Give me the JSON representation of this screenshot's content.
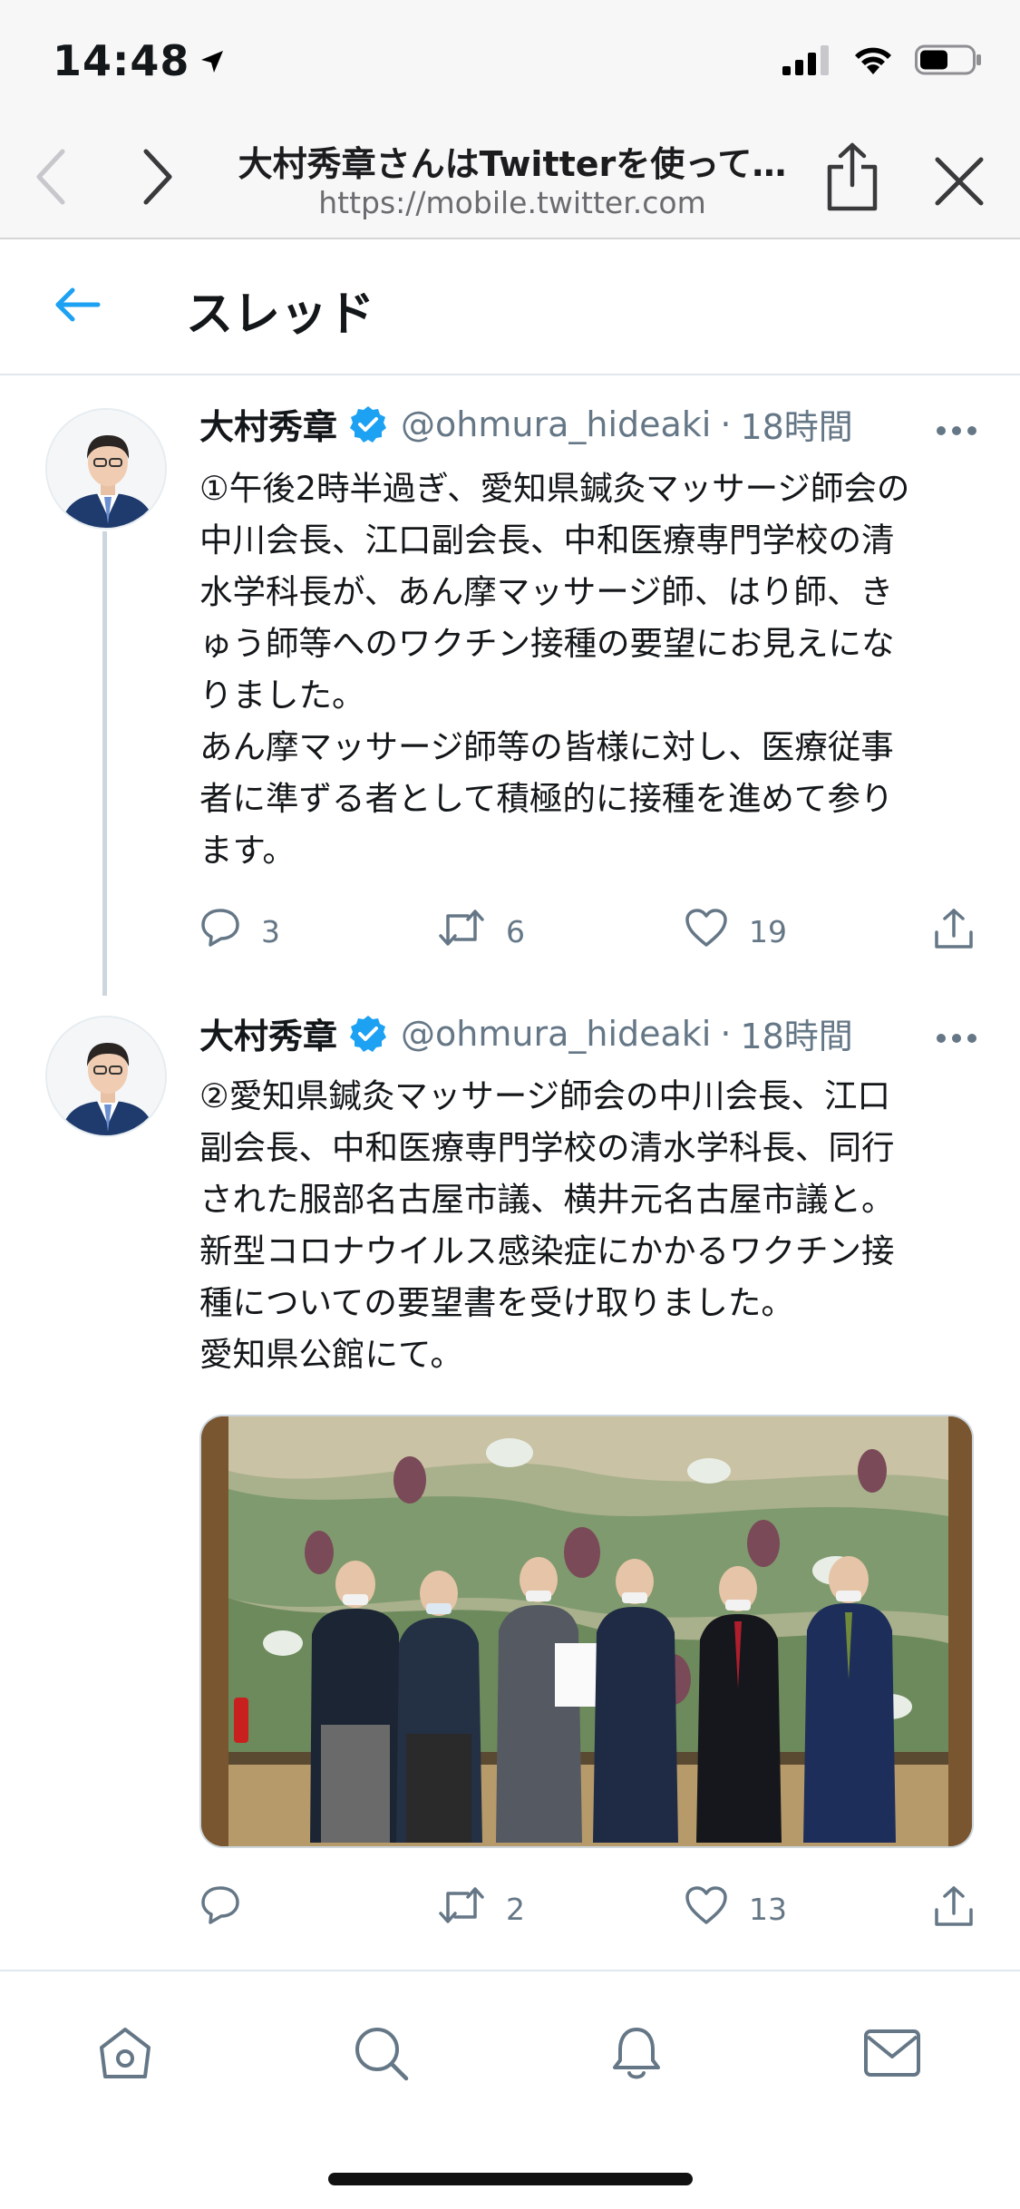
{
  "status_bar": {
    "time": "14:48",
    "icons": [
      "location-arrow-icon",
      "cellular-signal-icon",
      "wifi-icon",
      "battery-icon"
    ]
  },
  "browser": {
    "page_title": "大村秀章さんはTwitterを使って…",
    "url": "https://mobile.twitter.com",
    "icons": [
      "back-chevron-icon",
      "forward-chevron-icon",
      "share-icon",
      "close-icon"
    ]
  },
  "thread": {
    "title": "スレッド",
    "back_icon": "back-arrow-icon"
  },
  "tweets": [
    {
      "author": "大村秀章",
      "handle": "@ohmura_hideaki",
      "separator": "·",
      "time": "18時間",
      "lines": [
        "①午後2時半過ぎ、愛知県鍼灸マッサージ師会の",
        "中川会長、江口副会長、中和医療専門学校の清",
        "水学科長が、あん摩マッサージ師、はり師、き",
        "ゅう師等へのワクチン接種の要望にお見えにな",
        "りました。",
        "あん摩マッサージ師等の皆様に対し、医療従事",
        "者に準ずる者として積極的に接種を進めて参り",
        "ます。"
      ],
      "reply_count": "3",
      "retweet_count": "6",
      "like_count": "19"
    },
    {
      "author": "大村秀章",
      "handle": "@ohmura_hideaki",
      "separator": "·",
      "time": "18時間",
      "lines": [
        "②愛知県鍼灸マッサージ師会の中川会長、江口",
        "副会長、中和医療専門学校の清水学科長、同行",
        "された服部名古屋市議、横井元名古屋市議と。",
        "新型コロナウイルス感染症にかかるワクチン接",
        "種についての要望書を受け取りました。",
        "愛知県公館にて。"
      ],
      "reply_count": "",
      "retweet_count": "2",
      "like_count": "13"
    }
  ],
  "tab_bar": {
    "items": [
      "home-icon",
      "search-icon",
      "notifications-bell-icon",
      "messages-mail-icon"
    ]
  },
  "colors": {
    "twitter_blue": "#1da1f2",
    "secondary_text": "#657786",
    "divider": "#e1e8ed"
  }
}
